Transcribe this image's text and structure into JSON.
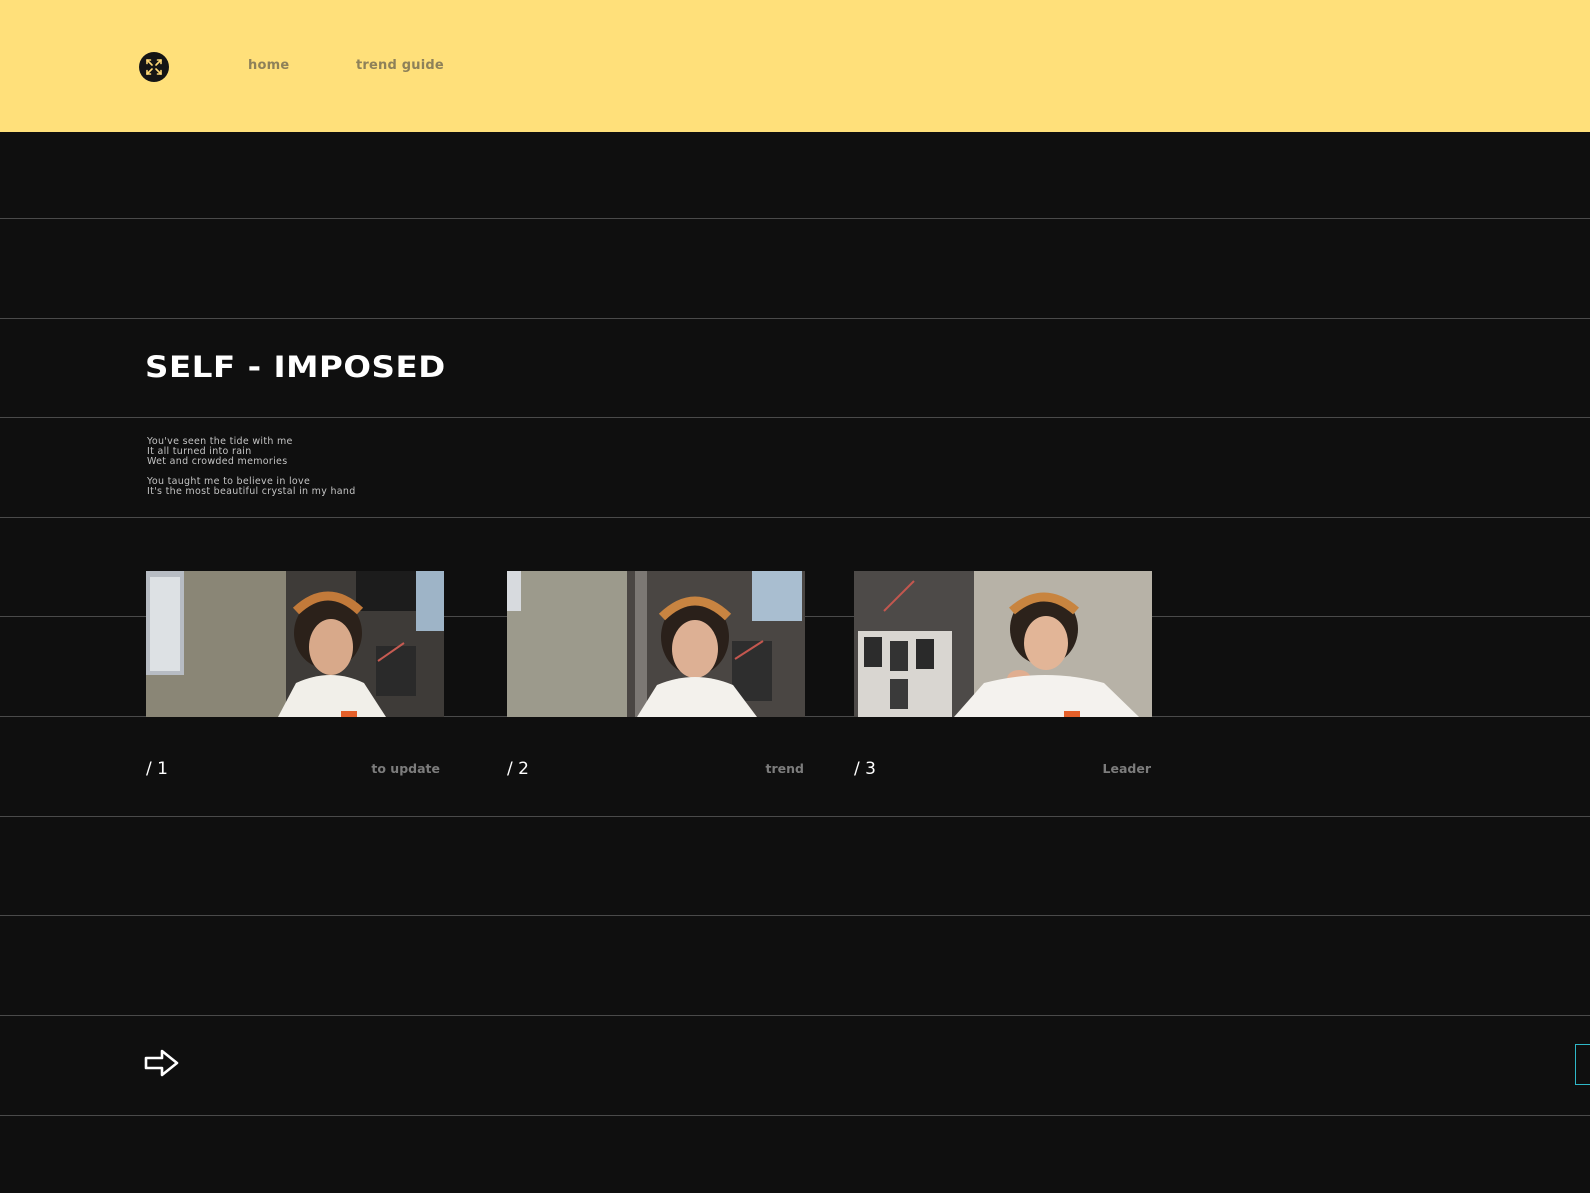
{
  "header": {
    "logo_icon": "expand-arrows-icon",
    "nav": [
      {
        "label": "home"
      },
      {
        "label": "trend guide"
      }
    ]
  },
  "hero": {
    "title": "SELF - IMPOSED",
    "lyrics": {
      "stanza1": [
        "You've seen the tide with me",
        "It all turned into rain",
        "Wet and crowded memories"
      ],
      "stanza2": [
        "You taught me to believe in love",
        "It's the most beautiful crystal in my hand"
      ]
    }
  },
  "cards": [
    {
      "number": "/ 1",
      "label": "to update"
    },
    {
      "number": "/ 2",
      "label": "trend"
    },
    {
      "number": "/ 3",
      "label": "Leader"
    }
  ],
  "controls": {
    "next_icon": "arrow-right-icon"
  },
  "colors": {
    "header_bg": "#ffe07a",
    "page_bg": "#0f0f0f",
    "nav_text": "#8e8159",
    "accent_tab": "#2fb8c8"
  }
}
